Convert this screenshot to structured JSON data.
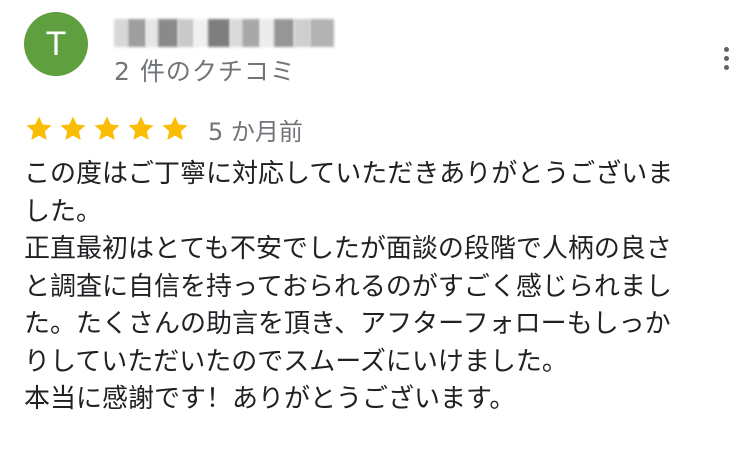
{
  "reviewer": {
    "avatar_letter": "T",
    "avatar_color": "#5f9f3f",
    "review_count": "2 件のクチコミ"
  },
  "rating": {
    "stars": 5,
    "max_stars": 5,
    "star_color": "#fbbc04",
    "time_ago": "5 か月前"
  },
  "review": {
    "lines": [
      "この度はご丁寧に対応していただきありがとうございま",
      "した。",
      "正直最初はとても不安でしたが面談の段階で人柄の良さ",
      "と調査に自信を持っておられるのがすごく感じられまし",
      "た。たくさんの助言を頂き、アフターフォローもしっか",
      "りしていただいたのでスムーズにいけました。",
      "本当に感謝です！ありがとうございます。"
    ]
  },
  "icons": {
    "menu": "more-vert-icon",
    "star": "star-icon"
  }
}
